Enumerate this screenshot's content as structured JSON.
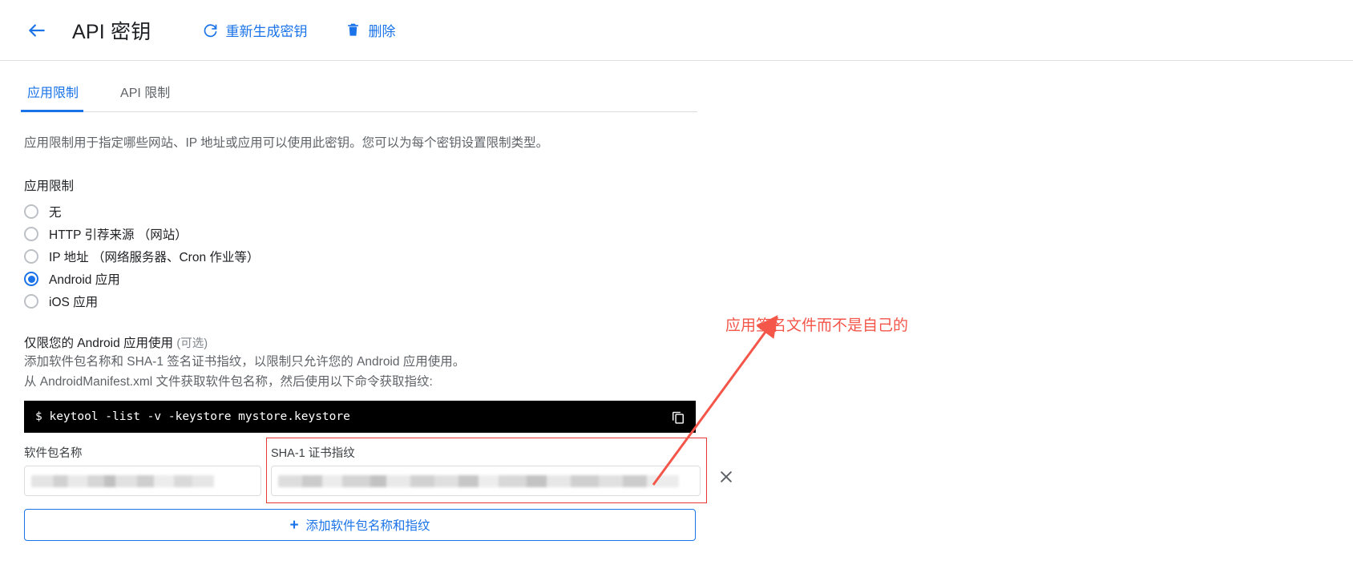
{
  "topbar": {
    "back_icon": "arrow-left-icon",
    "title": "API 密钥",
    "actions": [
      {
        "icon": "refresh-icon",
        "label": "重新生成密钥"
      },
      {
        "icon": "trash-icon",
        "label": "删除"
      }
    ]
  },
  "tabs": [
    {
      "label": "应用限制",
      "active": true
    },
    {
      "label": "API 限制",
      "active": false
    }
  ],
  "main": {
    "description": "应用限制用于指定哪些网站、IP 地址或应用可以使用此密钥。您可以为每个密钥设置限制类型。",
    "section_label": "应用限制",
    "radios": [
      {
        "label": "无",
        "checked": false
      },
      {
        "label": "HTTP 引荐来源 （网站）",
        "checked": false
      },
      {
        "label": "IP 地址 （网络服务器、Cron 作业等）",
        "checked": false
      },
      {
        "label": "Android 应用",
        "checked": true
      },
      {
        "label": "iOS 应用",
        "checked": false
      }
    ],
    "android": {
      "title": "仅限您的 Android 应用使用",
      "optional": "(可选)",
      "line1": "添加软件包名称和 SHA-1 签名证书指纹，以限制只允许您的 Android 应用使用。",
      "line2": "从 AndroidManifest.xml 文件获取软件包名称，然后使用以下命令获取指纹:",
      "code": "$ keytool -list -v -keystore mystore.keystore",
      "copy_icon": "copy-icon"
    },
    "fields": {
      "package_label": "软件包名称",
      "package_value": "",
      "sha_label": "SHA-1 证书指纹",
      "sha_value": "",
      "remove_icon": "close-icon"
    },
    "add_button": {
      "plus_icon": "plus-icon",
      "label": "添加软件包名称和指纹"
    }
  },
  "annotation": {
    "text": "应用签名文件而不是自己的",
    "color": "#f4564a",
    "arrow_icon": "arrow-pointer-icon"
  },
  "colors": {
    "accent": "#1a73e8",
    "text_primary": "#202124",
    "text_secondary": "#5f6368",
    "annotation_red": "#f4564a",
    "highlight_border": "#e53935",
    "code_bg": "#000000"
  }
}
